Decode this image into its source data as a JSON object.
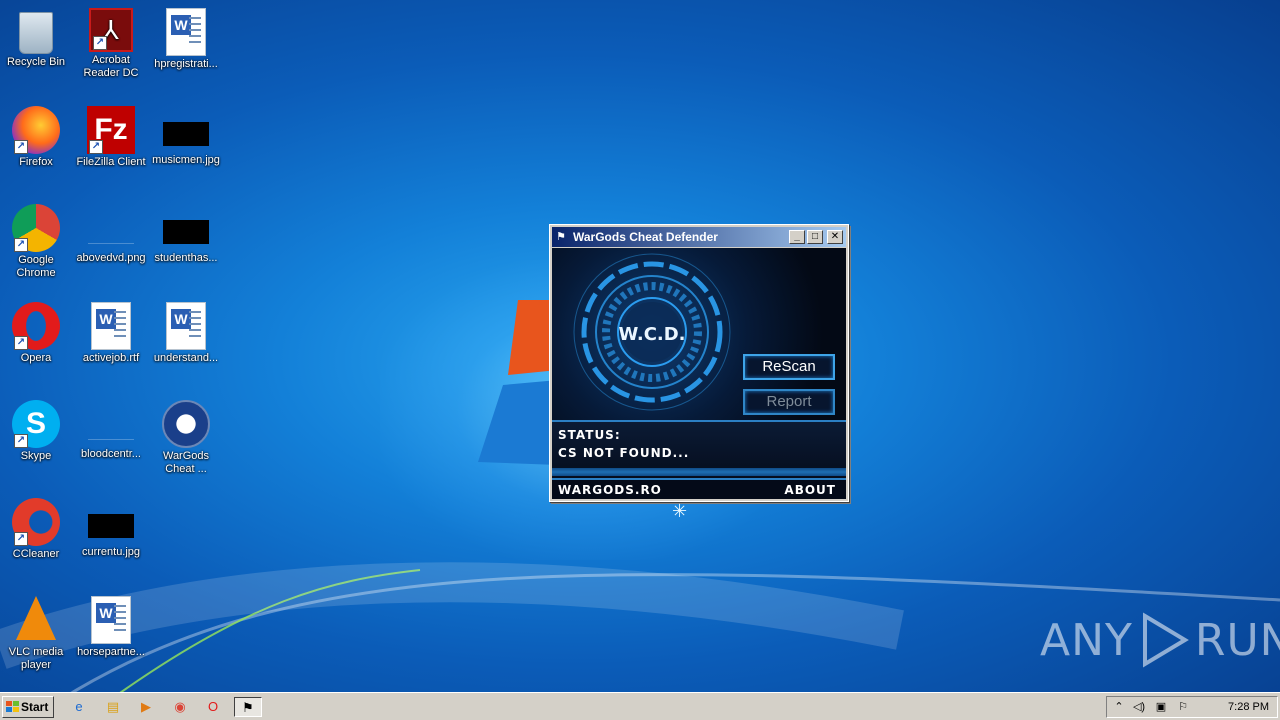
{
  "desktop": {
    "icons": [
      {
        "label": "Recycle Bin",
        "icon": "recycle-bin-icon"
      },
      {
        "label": "Acrobat Reader DC",
        "icon": "acrobat-reader-icon"
      },
      {
        "label": "hpregistrati...",
        "icon": "word-document-icon"
      },
      {
        "label": "Firefox",
        "icon": "firefox-icon"
      },
      {
        "label": "FileZilla Client",
        "icon": "filezilla-icon"
      },
      {
        "label": "musicmen.jpg",
        "icon": "image-file-icon"
      },
      {
        "label": "Google Chrome",
        "icon": "chrome-icon"
      },
      {
        "label": "abovedvd.png",
        "icon": "image-file-icon"
      },
      {
        "label": "studenthas...",
        "icon": "image-file-icon"
      },
      {
        "label": "Opera",
        "icon": "opera-icon"
      },
      {
        "label": "activejob.rtf",
        "icon": "word-document-icon"
      },
      {
        "label": "understand...",
        "icon": "word-document-icon"
      },
      {
        "label": "Skype",
        "icon": "skype-icon"
      },
      {
        "label": "bloodcentr...",
        "icon": "image-file-icon"
      },
      {
        "label": "WarGods Cheat ...",
        "icon": "wargods-icon"
      },
      {
        "label": "CCleaner",
        "icon": "ccleaner-icon"
      },
      {
        "label": "currentu.jpg",
        "icon": "image-file-icon"
      },
      {
        "label": "VLC media player",
        "icon": "vlc-icon"
      },
      {
        "label": "horsepartne...",
        "icon": "word-document-icon"
      }
    ]
  },
  "app_window": {
    "title": "WarGods Cheat Defender",
    "logo_text": "W.C.D.",
    "rescan_label": "ReScan",
    "report_label": "Report",
    "status_label": "STATUS:",
    "status_value": "CS NOT FOUND...",
    "site_link": "WARGODS.RO",
    "about_link": "ABOUT"
  },
  "taskbar": {
    "start_label": "Start",
    "clock": "7:28 PM"
  },
  "watermark": {
    "left": "ANY",
    "right": "RUN"
  },
  "colors": {
    "accent": "#3ea4e8",
    "titlebar": "#0a246a",
    "desktop": "#1380d8"
  }
}
